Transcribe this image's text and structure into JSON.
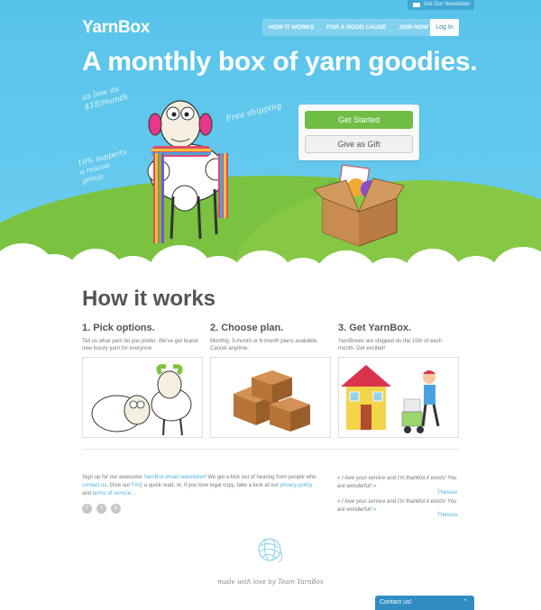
{
  "header": {
    "newsletter_tab": "Get Our Newsletter",
    "logo": "YarnBox",
    "nav": [
      "HOW IT WORKS",
      "FOR A GOOD CAUSE",
      "JOIN NOW"
    ],
    "login": "Log In"
  },
  "hero": {
    "headline": "A monthly box of yarn goodies.",
    "price_note": "as low as\n$18/month",
    "shipping_note": "Free shipping",
    "cause_note": "10% supports\na rescue\ngroup",
    "get_started": "Get Started",
    "give_gift": "Give as Gift"
  },
  "how": {
    "title": "How it works",
    "steps": [
      {
        "title": "1. Pick options.",
        "text": "Tell us what yarn do you prefer. We've got brand new luxury yarn for everyone."
      },
      {
        "title": "2. Choose plan.",
        "text": "Monthly, 3-month or 6-month plans available. Cancel anytime."
      },
      {
        "title": "3. Get YarnBox.",
        "text": "YarnBoxes are shipped on the 15th of each month. Get excited!"
      }
    ]
  },
  "footer": {
    "t1": "Sign up for our awesome ",
    "newsletter_link": "YarnBox email newsletter",
    "t2": "! We get a kick out of hearing from people who ",
    "contact_link": "contact us",
    "t3": ". Give our ",
    "faq_link": "FAQ",
    "t4": " a quick read, or, if you love legal copy, take a look at our ",
    "privacy_link": "privacy policy",
    "t5": " and ",
    "terms_link": "terms of service",
    "t6": "...",
    "testimonials": [
      {
        "text": "I love your service and I'm thankful it exists! You are wonderful!",
        "author": "Theresa"
      },
      {
        "text": "I love your service and I'm thankful it exists! You are wonderful!",
        "author": "Theresa"
      }
    ],
    "social": [
      "f",
      "t",
      "p"
    ],
    "tagline": "made with love by Team YarnBox",
    "contact_tab": "Contact us!"
  }
}
